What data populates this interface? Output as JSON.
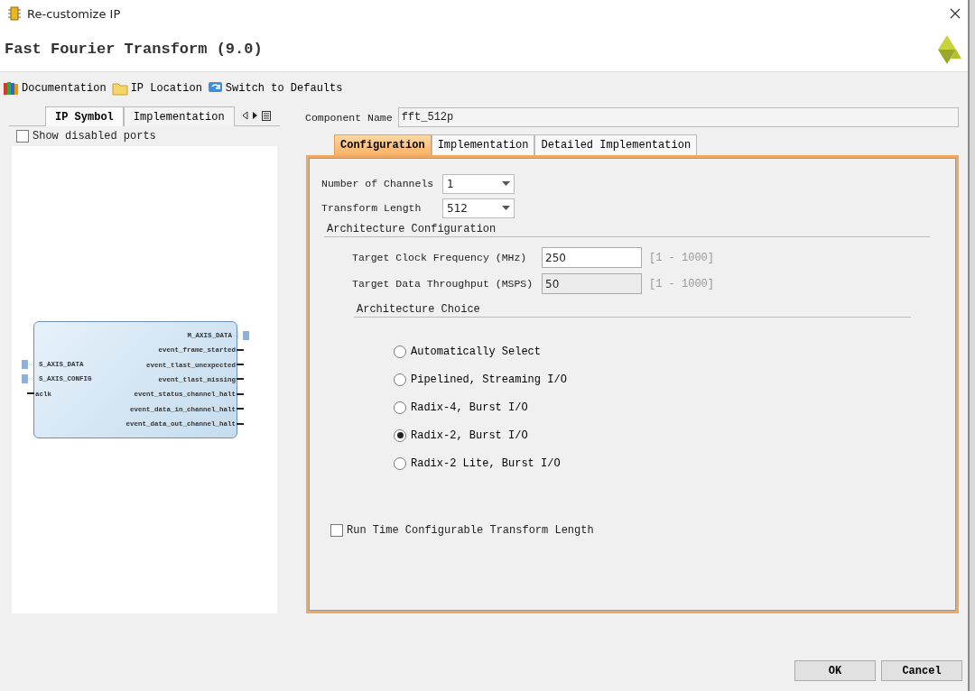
{
  "window": {
    "title": "Re-customize IP"
  },
  "header": {
    "title": "Fast Fourier Transform (9.0)"
  },
  "toolbar": [
    {
      "label": "Documentation",
      "kind": "books"
    },
    {
      "label": "IP Location",
      "kind": "folder"
    },
    {
      "label": "Switch to Defaults",
      "kind": "refresh"
    }
  ],
  "left_panel": {
    "tabs": [
      {
        "label": "IP Symbol",
        "selected": true
      },
      {
        "label": "Implementation",
        "selected": false
      }
    ],
    "show_disabled_ports": {
      "label": "Show disabled ports",
      "checked": false
    },
    "symbol": {
      "left_ports": [
        {
          "name": "S_AXIS_DATA",
          "kind": "bus"
        },
        {
          "name": "S_AXIS_CONFIG",
          "kind": "bus"
        },
        {
          "name": "aclk",
          "kind": "wire"
        }
      ],
      "right_ports": [
        {
          "name": "M_AXIS_DATA",
          "kind": "bus"
        },
        {
          "name": "event_frame_started",
          "kind": "wire"
        },
        {
          "name": "event_tlast_unexpected",
          "kind": "wire"
        },
        {
          "name": "event_tlast_missing",
          "kind": "wire"
        },
        {
          "name": "event_status_channel_halt",
          "kind": "wire"
        },
        {
          "name": "event_data_in_channel_halt",
          "kind": "wire"
        },
        {
          "name": "event_data_out_channel_halt",
          "kind": "wire"
        }
      ]
    }
  },
  "component_name": {
    "label": "Component Name",
    "value": "fft_512p"
  },
  "config_tabs": [
    {
      "label": "Configuration",
      "selected": true
    },
    {
      "label": "Implementation",
      "selected": false
    },
    {
      "label": "Detailed Implementation",
      "selected": false
    }
  ],
  "dropdowns": [
    {
      "label": "Number of Channels",
      "value": "1"
    },
    {
      "label": "Transform Length",
      "value": "512"
    }
  ],
  "architecture_configuration": {
    "title": "Architecture Configuration",
    "fields": [
      {
        "label": "Target Clock Frequency (MHz)",
        "value": "250",
        "range": "[1 - 1000]",
        "disabled": false
      },
      {
        "label": "Target Data Throughput (MSPS)",
        "value": "50",
        "range": "[1 - 1000]",
        "disabled": true
      }
    ]
  },
  "architecture_choice": {
    "title": "Architecture Choice",
    "options": [
      {
        "label": "Automatically Select",
        "selected": false
      },
      {
        "label": "Pipelined, Streaming I/O",
        "selected": false
      },
      {
        "label": "Radix-4, Burst I/O",
        "selected": false
      },
      {
        "label": "Radix-2, Burst I/O",
        "selected": true
      },
      {
        "label": "Radix-2 Lite, Burst I/O",
        "selected": false
      }
    ]
  },
  "run_time_configurable": {
    "label": "Run Time Configurable Transform Length",
    "checked": false
  },
  "buttons": [
    "OK",
    "Cancel"
  ]
}
